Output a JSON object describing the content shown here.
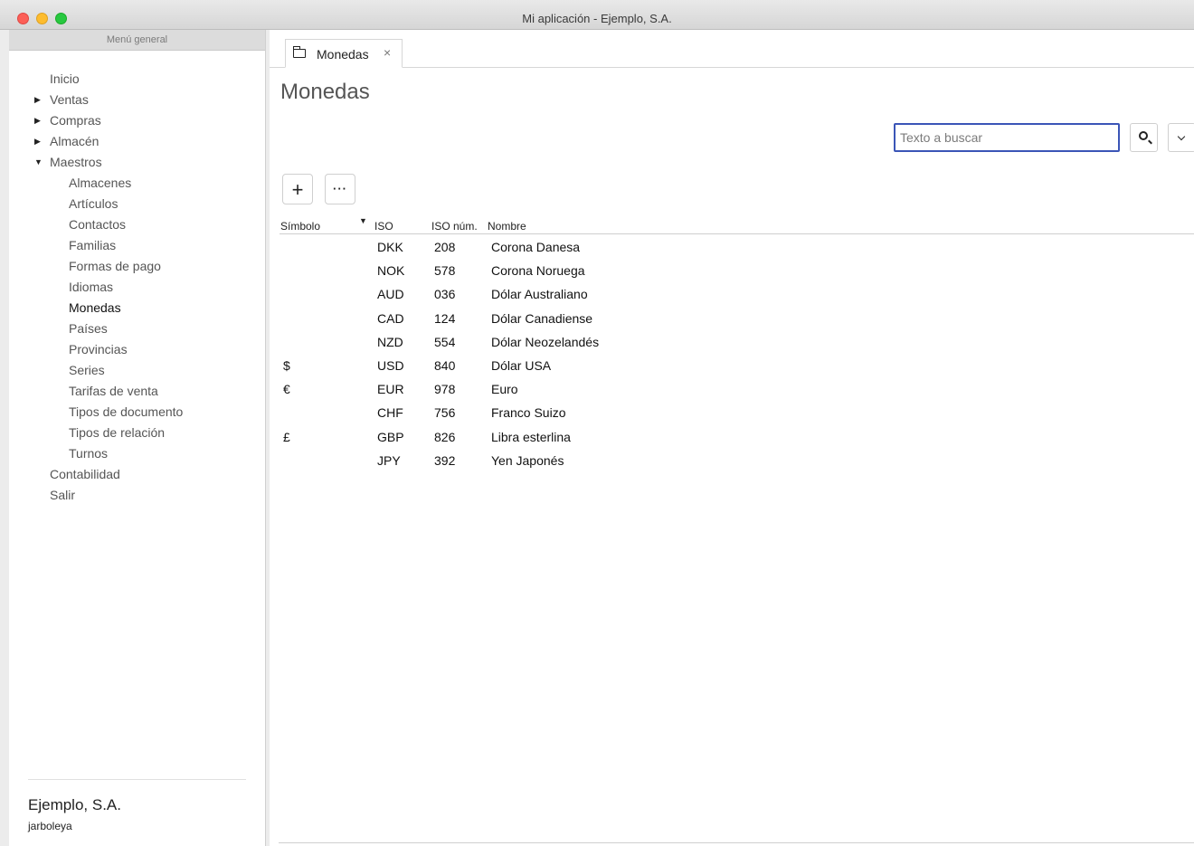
{
  "window": {
    "title": "Mi aplicación - Ejemplo, S.A."
  },
  "sidebar": {
    "header": "Menú general",
    "items": [
      {
        "label": "Inicio",
        "level": 1,
        "arrow": ""
      },
      {
        "label": "Ventas",
        "level": 1,
        "arrow": "right"
      },
      {
        "label": "Compras",
        "level": 1,
        "arrow": "right"
      },
      {
        "label": "Almacén",
        "level": 1,
        "arrow": "right"
      },
      {
        "label": "Maestros",
        "level": 1,
        "arrow": "down"
      },
      {
        "label": "Almacenes",
        "level": 2,
        "arrow": ""
      },
      {
        "label": "Artículos",
        "level": 2,
        "arrow": ""
      },
      {
        "label": "Contactos",
        "level": 2,
        "arrow": ""
      },
      {
        "label": "Familias",
        "level": 2,
        "arrow": ""
      },
      {
        "label": "Formas de pago",
        "level": 2,
        "arrow": ""
      },
      {
        "label": "Idiomas",
        "level": 2,
        "arrow": ""
      },
      {
        "label": "Monedas",
        "level": 2,
        "arrow": "",
        "active": true
      },
      {
        "label": "Países",
        "level": 2,
        "arrow": ""
      },
      {
        "label": "Provincias",
        "level": 2,
        "arrow": ""
      },
      {
        "label": "Series",
        "level": 2,
        "arrow": ""
      },
      {
        "label": "Tarifas de venta",
        "level": 2,
        "arrow": ""
      },
      {
        "label": "Tipos de documento",
        "level": 2,
        "arrow": ""
      },
      {
        "label": "Tipos de relación",
        "level": 2,
        "arrow": ""
      },
      {
        "label": "Turnos",
        "level": 2,
        "arrow": ""
      },
      {
        "label": "Contabilidad",
        "level": 1,
        "arrow": ""
      },
      {
        "label": "Salir",
        "level": 1,
        "arrow": ""
      }
    ],
    "company": "Ejemplo, S.A.",
    "user": "jarboleya"
  },
  "tabs": [
    {
      "label": "Monedas",
      "icon": "folder-icon",
      "close": "×"
    }
  ],
  "main": {
    "title": "Monedas",
    "search": {
      "placeholder": "Texto a buscar",
      "value": ""
    },
    "actions": {
      "add": "+",
      "more": "···"
    }
  },
  "table": {
    "columns": [
      "Símbolo",
      "ISO",
      "ISO núm.",
      "Nombre"
    ],
    "rows": [
      {
        "symbol": "",
        "iso": "DKK",
        "num": "208",
        "name": "Corona Danesa"
      },
      {
        "symbol": "",
        "iso": "NOK",
        "num": "578",
        "name": "Corona Noruega"
      },
      {
        "symbol": "",
        "iso": "AUD",
        "num": "036",
        "name": "Dólar Australiano"
      },
      {
        "symbol": "",
        "iso": "CAD",
        "num": "124",
        "name": "Dólar Canadiense"
      },
      {
        "symbol": "",
        "iso": "NZD",
        "num": "554",
        "name": "Dólar Neozelandés"
      },
      {
        "symbol": "$",
        "iso": "USD",
        "num": "840",
        "name": "Dólar USA"
      },
      {
        "symbol": "€",
        "iso": "EUR",
        "num": "978",
        "name": "Euro"
      },
      {
        "symbol": "",
        "iso": "CHF",
        "num": "756",
        "name": "Franco Suizo"
      },
      {
        "symbol": "£",
        "iso": "GBP",
        "num": "826",
        "name": "Libra esterlina"
      },
      {
        "symbol": "",
        "iso": "JPY",
        "num": "392",
        "name": "Yen Japonés"
      }
    ]
  }
}
